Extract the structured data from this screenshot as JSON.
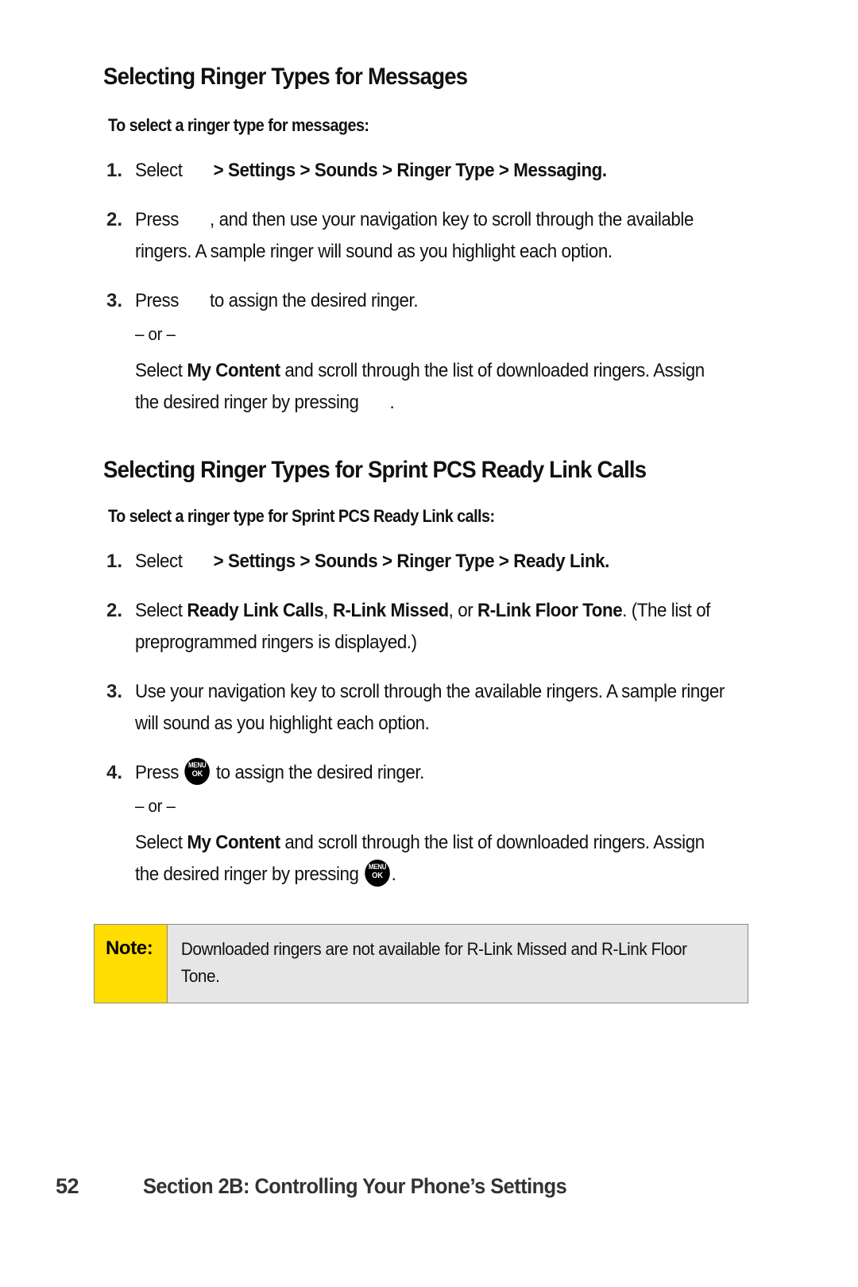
{
  "document": {
    "page_number": "52",
    "footer_title": "Section 2B: Controlling Your Phone’s Settings"
  },
  "colors": {
    "note_label_background": "#ffdd00",
    "note_body_background": "#e6e6e6",
    "note_border": "#8a8a8a",
    "text": "#111111",
    "icon_background": "#000000"
  },
  "sections": [
    {
      "heading": "Selecting Ringer Types for Messages",
      "subhead": "To select a ringer type for messages:",
      "steps": [
        {
          "number": "1.",
          "lead": "Select",
          "icon": "blank-nav-icon",
          "path": "> Settings > Sounds > Ringer Type > Messaging."
        },
        {
          "number": "2.",
          "lead": "Press",
          "icon": "blank-nav-icon",
          "text": ", and then use your navigation key to scroll through the available ringers. A sample ringer will sound as you highlight each option."
        },
        {
          "number": "3.",
          "lead": "Press",
          "icon": "blank-nav-icon",
          "text": "to assign the desired ringer.",
          "or_label": "– or –",
          "alt_lead": "Select",
          "alt_bold": "My Content",
          "alt_text": "and scroll through the list of downloaded ringers. Assign the desired ringer by pressing",
          "alt_icon": "blank-nav-icon",
          "alt_tail": "."
        }
      ]
    },
    {
      "heading": "Selecting Ringer Types for Sprint PCS Ready Link Calls",
      "subhead": "To select a ringer type for Sprint PCS Ready Link calls:",
      "steps": [
        {
          "number": "1.",
          "lead": "Select",
          "icon": "blank-nav-icon",
          "path": "> Settings > Sounds > Ringer Type > Ready Link."
        },
        {
          "number": "2.",
          "lead": "Select",
          "bold_1": "Ready Link Calls",
          "sep_1": ",",
          "bold_2": "R-Link Missed",
          "sep_2": ", or",
          "bold_3": "R-Link Floor Tone",
          "tail": ". (The list of preprogrammed ringers is displayed.)"
        },
        {
          "number": "3.",
          "text": "Use your navigation key to scroll through the available ringers. A sample ringer will sound as you highlight each option."
        },
        {
          "number": "4.",
          "lead": "Press",
          "icon": "menu-ok-icon",
          "text": "to assign the desired ringer.",
          "or_label": "– or –",
          "alt_lead": "Select",
          "alt_bold": "My Content",
          "alt_text": "and scroll through the list of downloaded ringers. Assign the desired ringer by pressing",
          "alt_icon": "menu-ok-icon",
          "alt_tail": "."
        }
      ]
    }
  ],
  "icons": {
    "menu_ok": {
      "top_label": "MENU",
      "bottom_label": "OK"
    }
  },
  "note": {
    "label": "Note:",
    "text": "Downloaded ringers are not available for R-Link Missed and R-Link Floor Tone."
  }
}
